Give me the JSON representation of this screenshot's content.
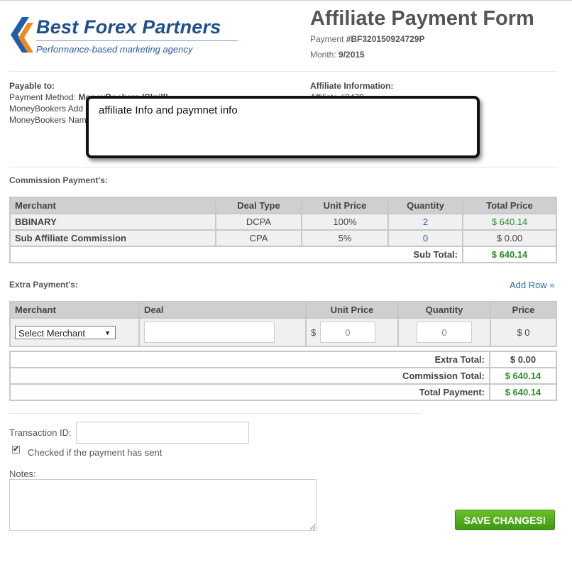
{
  "brand": {
    "name": "Best Forex Partners",
    "tagline": "Performance-based marketing agency",
    "logo_colors": [
      "#1f5fa8",
      "#f08a1c"
    ]
  },
  "header": {
    "title": "Affiliate Payment Form",
    "payment_label": "Payment",
    "payment_id": "#BF320150924729P",
    "month_label": "Month:",
    "month_value": "9/2015"
  },
  "payable": {
    "heading": "Payable to:",
    "method_label": "Payment Method:",
    "method_value": "MoneyBookers (Skrill)",
    "line2": "MoneyBookers Add",
    "line3": "MoneyBookers Nam"
  },
  "affiliate": {
    "heading": "Affiliate Information:",
    "line1": "Affiliate #3479"
  },
  "callout": {
    "text": "affiliate Info and paymnet info"
  },
  "commission": {
    "title": "Commission Payment's:",
    "headers": [
      "Merchant",
      "Deal Type",
      "Unit Price",
      "Quantity",
      "Total Price"
    ],
    "rows": [
      {
        "merchant": "BBINARY",
        "deal_type": "DCPA",
        "unit_price": "100%",
        "quantity": "2",
        "total": "$ 640.14"
      },
      {
        "merchant": "Sub Affiliate Commission",
        "deal_type": "CPA",
        "unit_price": "5%",
        "quantity": "0",
        "total": "$ 0.00"
      }
    ],
    "subtotal_label": "Sub Total:",
    "subtotal_value": "$ 640.14"
  },
  "extra": {
    "title": "Extra Payment's:",
    "add_row": "Add Row »",
    "headers": [
      "Merchant",
      "Deal",
      "Unit Price",
      "Quantity",
      "Price"
    ],
    "merchant_select": "Select Merchant",
    "deal_value": "",
    "currency": "$",
    "unit_price_value": "0",
    "quantity_value": "0",
    "price_value": "$ 0"
  },
  "totals": {
    "extra_label": "Extra Total:",
    "extra_value": "$ 0.00",
    "commission_label": "Commission Total:",
    "commission_value": "$ 640.14",
    "payment_label": "Total Payment:",
    "payment_value": "$ 640.14"
  },
  "form": {
    "transaction_label": "Transaction ID:",
    "transaction_value": "",
    "checkbox_label": "Checked if the payment has sent",
    "checkbox_checked": true,
    "notes_label": "Notes:",
    "notes_value": "",
    "save_label": "SAVE CHANGES!"
  },
  "colors": {
    "accent_green": "#2e8b2e",
    "link_blue": "#2f6aa5",
    "button_green": "#4da81a"
  }
}
